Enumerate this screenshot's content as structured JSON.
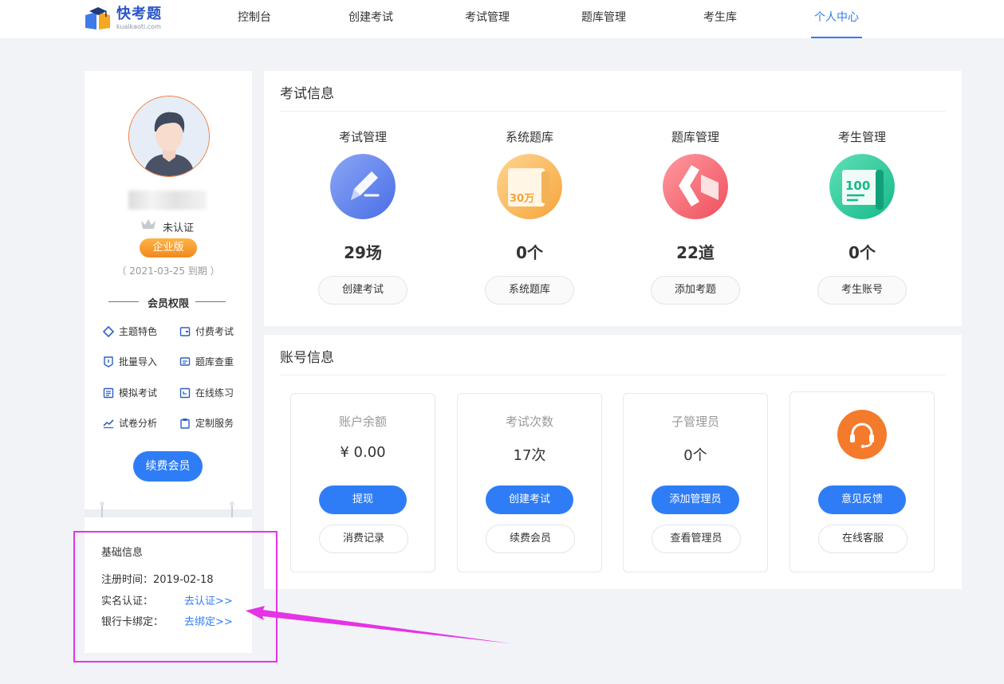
{
  "brand": {
    "title": "快考题",
    "subtitle": "kuaikaoti.com"
  },
  "nav": [
    {
      "label": "控制台"
    },
    {
      "label": "创建考试"
    },
    {
      "label": "考试管理"
    },
    {
      "label": "题库管理"
    },
    {
      "label": "考生库"
    },
    {
      "label": "个人中心",
      "active": true
    }
  ],
  "profile": {
    "cert_status": "未认证",
    "edition": "企业版",
    "expire": "（ 2021-03-25 到期 ）",
    "perm_title": "会员权限",
    "permissions": [
      {
        "label": "主题特色",
        "icon": "diamond-icon"
      },
      {
        "label": "付费考试",
        "icon": "wallet-icon"
      },
      {
        "label": "批量导入",
        "icon": "import-icon"
      },
      {
        "label": "题库查重",
        "icon": "duplicate-check-icon"
      },
      {
        "label": "模拟考试",
        "icon": "list-icon"
      },
      {
        "label": "在线练习",
        "icon": "practice-icon"
      },
      {
        "label": "试卷分析",
        "icon": "trend-icon"
      },
      {
        "label": "定制服务",
        "icon": "clipboard-icon"
      }
    ],
    "renew_label": "续费会员"
  },
  "basic_info": {
    "title": "基础信息",
    "register_time": "注册时间：2019-02-18",
    "realname_label": "实名认证：",
    "realname_link": "去认证>>",
    "bank_label": "银行卡绑定：",
    "bank_link": "去绑定>>"
  },
  "exam_info": {
    "title": "考试信息",
    "columns": [
      {
        "label": "考试管理",
        "value": "29场",
        "button": "创建考试",
        "icon": "pencil-icon"
      },
      {
        "label": "系统题库",
        "value": "0个",
        "button": "系统题库",
        "icon": "question-bank-icon",
        "icon_text": "30万"
      },
      {
        "label": "题库管理",
        "value": "22道",
        "button": "添加考题",
        "icon": "bank-manage-icon"
      },
      {
        "label": "考生管理",
        "value": "0个",
        "button": "考生账号",
        "icon": "score-icon",
        "icon_text": "100"
      }
    ]
  },
  "account_info": {
    "title": "账号信息",
    "cards": [
      {
        "label": "账户余额",
        "value": "¥ 0.00",
        "primary": "提现",
        "secondary": "消费记录"
      },
      {
        "label": "考试次数",
        "value": "17次",
        "primary": "创建考试",
        "secondary": "续费会员"
      },
      {
        "label": "子管理员",
        "value": "0个",
        "primary": "添加管理员",
        "secondary": "查看管理员"
      },
      {
        "label": "",
        "value": "",
        "primary": "意见反馈",
        "secondary": "在线客服",
        "icon": "headset-icon"
      }
    ]
  },
  "colors": {
    "accent": "#2f7df6",
    "highlight": "#e533e5",
    "badge": "#f08a1c"
  }
}
